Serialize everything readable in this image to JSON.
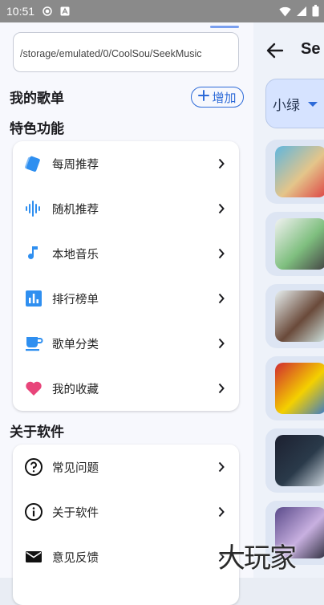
{
  "status_bar": {
    "time": "10:51"
  },
  "main": {
    "title": "Se",
    "source_select_value": "小绿",
    "cards": [
      {
        "name": "mv-card-1",
        "thumb_colors": [
          "#5fb6de",
          "#e4c58a",
          "#d44"
        ]
      },
      {
        "name": "mv-card-2",
        "thumb_colors": [
          "#f2f2f2",
          "#7fbf7f",
          "#444"
        ]
      },
      {
        "name": "mv-card-3",
        "thumb_colors": [
          "#e8f0f0",
          "#6a4a3a",
          "#cfe4e0"
        ]
      },
      {
        "name": "mv-card-4",
        "thumb_colors": [
          "#d02a30",
          "#f4d000",
          "#3a7ac8"
        ]
      },
      {
        "name": "mv-card-5",
        "thumb_colors": [
          "#1c2030",
          "#2a3a4a",
          "#cfd8e0"
        ]
      },
      {
        "name": "mv-card-6",
        "thumb_colors": [
          "#5a4a8a",
          "#c8b0e0",
          "#303040"
        ]
      }
    ]
  },
  "drawer": {
    "path_value": "/storage/emulated/0/CoolSou/SeekMusic",
    "my_playlists_title": "我的歌单",
    "add_label": "增加",
    "features_title": "特色功能",
    "features": [
      {
        "label": "每周推荐",
        "icon": "weekly-card-icon"
      },
      {
        "label": "随机推荐",
        "icon": "waveform-icon"
      },
      {
        "label": "本地音乐",
        "icon": "music-note-icon"
      },
      {
        "label": "排行榜单",
        "icon": "bar-chart-icon"
      },
      {
        "label": "歌单分类",
        "icon": "cup-icon"
      },
      {
        "label": "我的收藏",
        "icon": "heart-icon"
      }
    ],
    "about_title": "关于软件",
    "about": [
      {
        "label": "常见问题",
        "icon": "help-circle-icon"
      },
      {
        "label": "关于软件",
        "icon": "info-circle-icon"
      },
      {
        "label": "意见反馈",
        "icon": "mail-icon"
      }
    ]
  },
  "colors": {
    "accent": "#2e6bd8",
    "icon_blue": "#2f8ff0",
    "heart": "#e8457a"
  },
  "watermark": "大玩家"
}
